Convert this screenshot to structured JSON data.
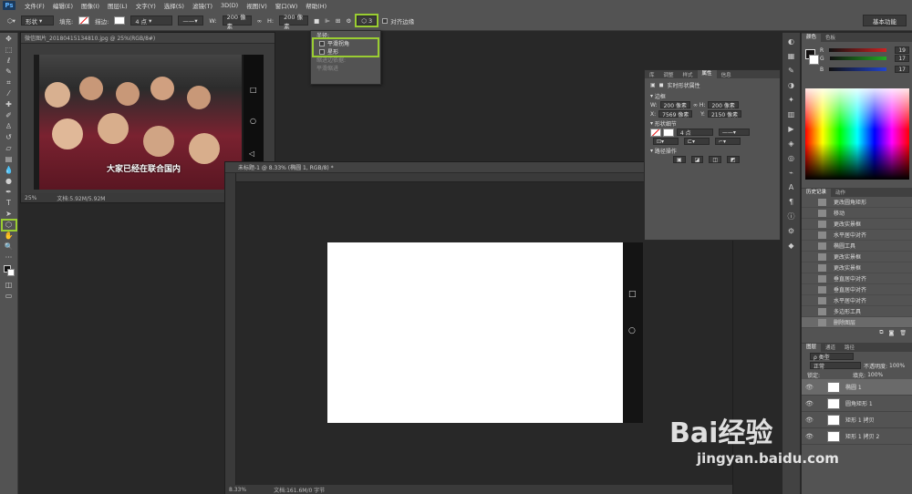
{
  "app": {
    "logo": "Ps"
  },
  "menu": [
    "文件(F)",
    "编辑(E)",
    "图像(I)",
    "图层(L)",
    "文字(Y)",
    "选择(S)",
    "滤镜(T)",
    "3D(D)",
    "视图(V)",
    "窗口(W)",
    "帮助(H)"
  ],
  "options": {
    "mode": "形状",
    "fill_label": "填充:",
    "stroke_label": "描边:",
    "stroke_size": "4 点",
    "w_label": "W:",
    "w_value": "200 像素",
    "h_label": "H:",
    "h_value": "200 像素",
    "radius": "3",
    "align_edges": "对齐边缘",
    "workspace": "基本功能"
  },
  "dropdown": {
    "title": "半径:",
    "option1": "平滑拐角",
    "option2": "星形",
    "option3": "缩进边依据:",
    "option4": "平滑缩进"
  },
  "doc1": {
    "title": "微信图片_20180415134810.jpg @ 25%(RGB/8#)",
    "zoom": "25%",
    "doc_size": "文档:5.92M/5.92M",
    "subtitle": "大家已经在联合国内"
  },
  "doc2": {
    "title": "未标题-1 @ 8.33% (椭圆 1, RGB/8) *",
    "zoom": "8.33%",
    "doc_size": "文档:161.6M/0 字节"
  },
  "properties": {
    "tabs": [
      "库",
      "调整",
      "样式",
      "属性",
      "信息"
    ],
    "active_tab": "属性",
    "header": "实时形状属性",
    "section_bounds": "边框",
    "w_label": "W:",
    "w_value": "200 像素",
    "h_label": "H:",
    "h_value": "200 像素",
    "x_label": "X:",
    "x_value": "7569 像素",
    "y_label": "Y:",
    "y_value": "2150 像素",
    "section_shape": "形状细节",
    "stroke_size": "4 点",
    "section_path": "路径操作"
  },
  "color_panel": {
    "tabs": [
      "颜色",
      "色板"
    ],
    "r_label": "R",
    "r_value": "19",
    "g_label": "G",
    "g_value": "17",
    "b_label": "B",
    "b_value": "17",
    "colors": {
      "r_slider": "#cc2222",
      "g_slider": "#22aa22",
      "b_slider": "#2244cc"
    }
  },
  "history_panel": {
    "tabs": [
      "历史记录",
      "动作"
    ],
    "items": [
      "更改圆角矩形",
      "移动",
      "更改实景框",
      "水平居中对齐",
      "椭圆工具",
      "更改实景框",
      "更改实景框",
      "垂直居中对齐",
      "垂直居中对齐",
      "水平居中对齐",
      "多边形工具",
      "删除图层"
    ]
  },
  "layers_panel": {
    "tabs": [
      "图层",
      "通道",
      "路径"
    ],
    "kind": "ρ 类型",
    "blend": "正常",
    "opacity_label": "不透明度:",
    "opacity_value": "100%",
    "lock_label": "锁定:",
    "fill_label": "填充:",
    "fill_value": "100%",
    "layers": [
      "椭圆 1",
      "圆角矩形 1",
      "矩形 1 拷贝",
      "矩形 1 拷贝 2"
    ]
  },
  "watermark": {
    "text": "Bai经验",
    "url": "jingyan.baidu.com"
  }
}
